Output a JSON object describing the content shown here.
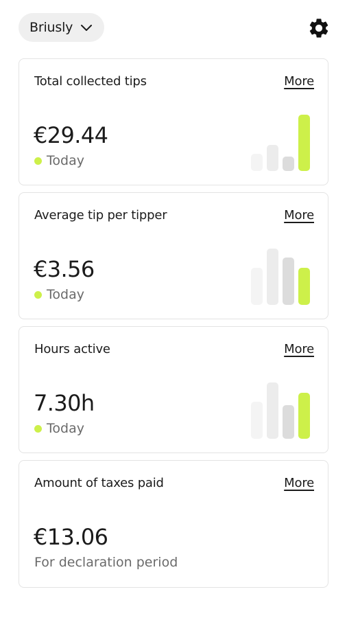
{
  "header": {
    "org_name": "Briusly"
  },
  "colors": {
    "accent": "#cdf04a",
    "bar_faint": "#f4f4f4",
    "bar_light": "#ececec",
    "bar_mid": "#dcdcdc"
  },
  "cards": [
    {
      "title": "Total collected tips",
      "more": "More",
      "value": "€29.44",
      "sub": "Today",
      "bars": [
        0.3,
        0.46,
        0.26,
        1.0
      ]
    },
    {
      "title": "Average tip per tipper",
      "more": "More",
      "value": "€3.56",
      "sub": "Today",
      "bars": [
        0.66,
        1.0,
        0.84,
        0.66
      ]
    },
    {
      "title": "Hours active",
      "more": "More",
      "value": "7.30h",
      "sub": "Today",
      "bars": [
        0.66,
        1.0,
        0.6,
        0.82
      ]
    },
    {
      "title": "Amount of taxes paid",
      "more": "More",
      "value": "€13.06",
      "sub": "For declaration period"
    }
  ]
}
